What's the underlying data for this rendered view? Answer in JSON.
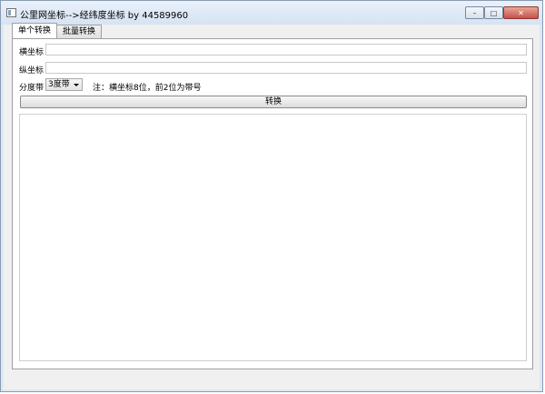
{
  "window": {
    "title": "公里网坐标-->经纬度坐标 by 44589960",
    "minimize_glyph": "–",
    "maximize_glyph": "□",
    "close_glyph": "✕"
  },
  "tabs": [
    {
      "label": "单个转换",
      "active": true
    },
    {
      "label": "批量转换",
      "active": false
    }
  ],
  "form": {
    "x_label": "横坐标",
    "x_value": "",
    "y_label": "纵坐标",
    "y_value": "",
    "zone_label": "分度带",
    "zone_selected": "3度带",
    "note": "注：横坐标8位，前2位为带号",
    "convert_button": "转换",
    "output_text": ""
  }
}
